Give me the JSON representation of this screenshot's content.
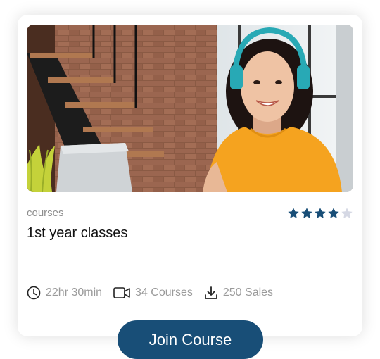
{
  "course_card": {
    "image_alt": "Woman with headphones smiling at a laptop",
    "category": "courses",
    "title": "1st year classes",
    "rating": {
      "value": 4,
      "max": 5,
      "filled_color": "#184e77",
      "empty_color": "#d5d8e4"
    },
    "meta": {
      "duration": "22hr 30min",
      "courses": "34 Courses",
      "sales": "250 Sales"
    },
    "icons": [
      "clock-icon",
      "video-icon",
      "download-icon"
    ],
    "join_label": "Join Course",
    "accent_color": "#184e77"
  }
}
